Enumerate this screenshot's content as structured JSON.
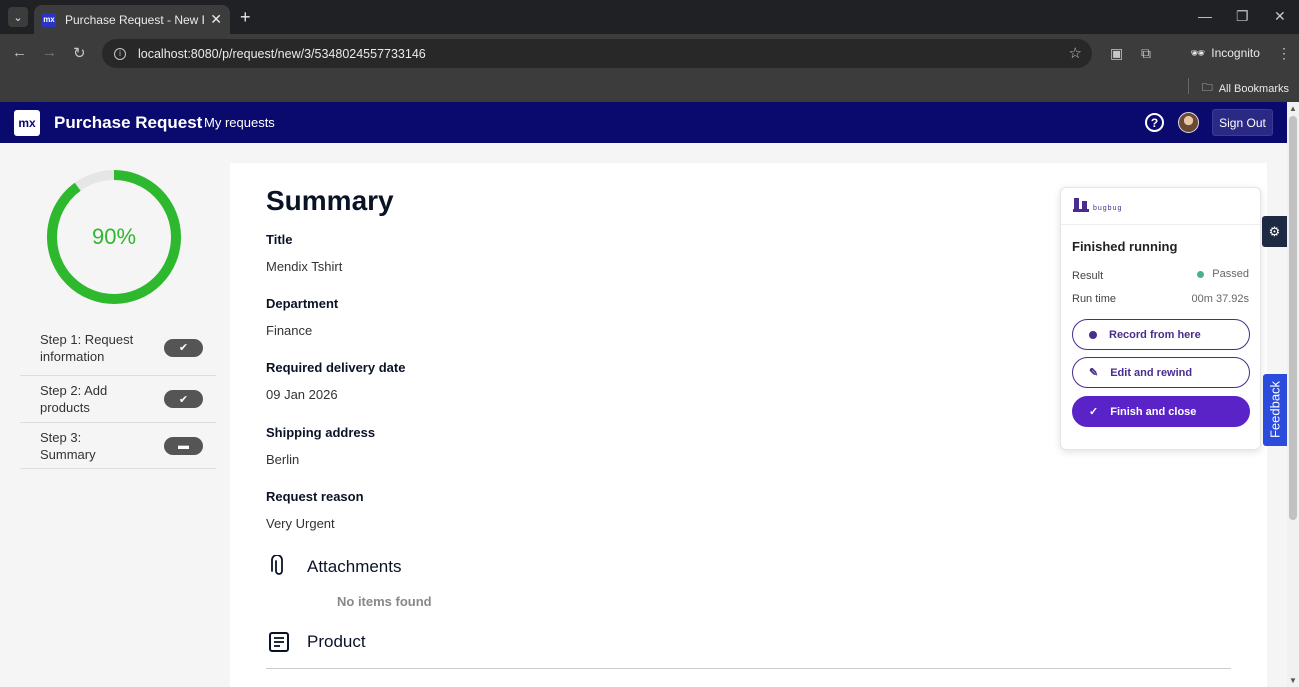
{
  "browser": {
    "tab_title": "Purchase Request - New Request",
    "tab_favicon": "mx",
    "url": "localhost:8080/p/request/new/3/5348024557733146",
    "incognito_label": "Incognito",
    "bookmarks_label": "All Bookmarks"
  },
  "header": {
    "logo": "mx",
    "title": "Purchase Request",
    "nav_link": "My requests",
    "help": "?",
    "signout": "Sign Out"
  },
  "sidebar": {
    "progress": {
      "percent_label": "90%",
      "value": 0.9,
      "color": "#2eb82e"
    },
    "steps": [
      {
        "label": "Step 1: Request information",
        "status": "done"
      },
      {
        "label": "Step 2: Add products",
        "status": "done"
      },
      {
        "label": "Step 3: Summary",
        "status": "current"
      }
    ]
  },
  "main": {
    "heading": "Summary",
    "fields": [
      {
        "label": "Title",
        "value": "Mendix Tshirt"
      },
      {
        "label": "Department",
        "value": "Finance"
      },
      {
        "label": "Required delivery date",
        "value": "09 Jan 2026"
      },
      {
        "label": "Shipping address",
        "value": "Berlin"
      },
      {
        "label": "Request reason",
        "value": "Very Urgent"
      }
    ],
    "attachments": {
      "heading": "Attachments",
      "empty": "No items found"
    },
    "product": {
      "heading": "Product"
    }
  },
  "bugbug": {
    "logo_text": "bugbug",
    "status": "Finished running",
    "result_label": "Result",
    "result_value": "Passed",
    "runtime_label": "Run time",
    "runtime_value": "00m 37.92s",
    "record_btn": "Record from here",
    "edit_btn": "Edit and rewind",
    "finish_btn": "Finish and close",
    "accent": "#5a23c8"
  },
  "feedback_tab": "Feedback"
}
